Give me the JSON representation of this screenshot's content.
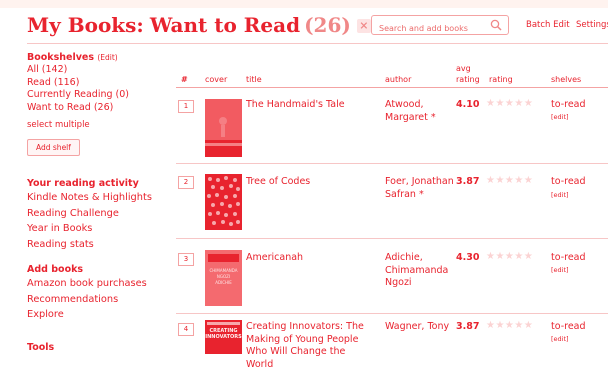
{
  "header": {
    "title": "My Books:",
    "shelf": "Want to Read",
    "count": "(26)",
    "clear_icon": "×",
    "search_placeholder": "Search and add books",
    "batch_edit": "Batch Edit",
    "settings": "Settings"
  },
  "sidebar": {
    "bookshelves_heading": "Bookshelves",
    "bookshelves_edit": "(Edit)",
    "shelves": [
      "All (142)",
      "Read (116)",
      "Currently Reading (0)",
      "Want to Read (26)"
    ],
    "select_multiple": "select multiple",
    "add_shelf": "Add shelf",
    "activity_heading": "Your reading activity",
    "activity_links": [
      "Kindle Notes & Highlights",
      "Reading Challenge",
      "Year in Books",
      "Reading stats"
    ],
    "add_books_heading": "Add books",
    "add_books_links": [
      "Amazon book purchases",
      "Recommendations",
      "Explore"
    ],
    "tools_heading": "Tools"
  },
  "table": {
    "columns": {
      "num": "#",
      "cover": "cover",
      "title": "title",
      "author": "author",
      "avg_line1": "avg",
      "avg_line2": "rating",
      "rating": "rating",
      "shelves": "shelves"
    },
    "rows": [
      {
        "pos": "1",
        "title": "The Handmaid's Tale",
        "author": "Atwood, Margaret *",
        "avg": "4.10",
        "stars": "★★★★★",
        "shelf": "to-read",
        "edit": "[edit]"
      },
      {
        "pos": "2",
        "title": "Tree of Codes",
        "author": "Foer, Jonathan Safran *",
        "avg": "3.87",
        "stars": "★★★★★",
        "shelf": "to-read",
        "edit": "[edit]"
      },
      {
        "pos": "3",
        "title": "Americanah",
        "author": "Adichie, Chimamanda Ngozi",
        "avg": "4.30",
        "stars": "★★★★★",
        "shelf": "to-read",
        "edit": "[edit]",
        "cover_text": [
          "CHIMAMANDA",
          "NGOZI",
          "ADICHIE"
        ]
      },
      {
        "pos": "4",
        "title": "Creating Innovators: The Making of Young People Who Will Change the World",
        "author": "Wagner, Tony",
        "avg": "3.87",
        "stars": "★★★★★",
        "shelf": "to-read",
        "edit": "[edit]",
        "cover_text": [
          "CREATING",
          "INNOVATORS"
        ]
      }
    ]
  },
  "colors": {
    "accent": "#e8232e",
    "muted": "#f08888",
    "star_empty": "#fbd3d3"
  }
}
